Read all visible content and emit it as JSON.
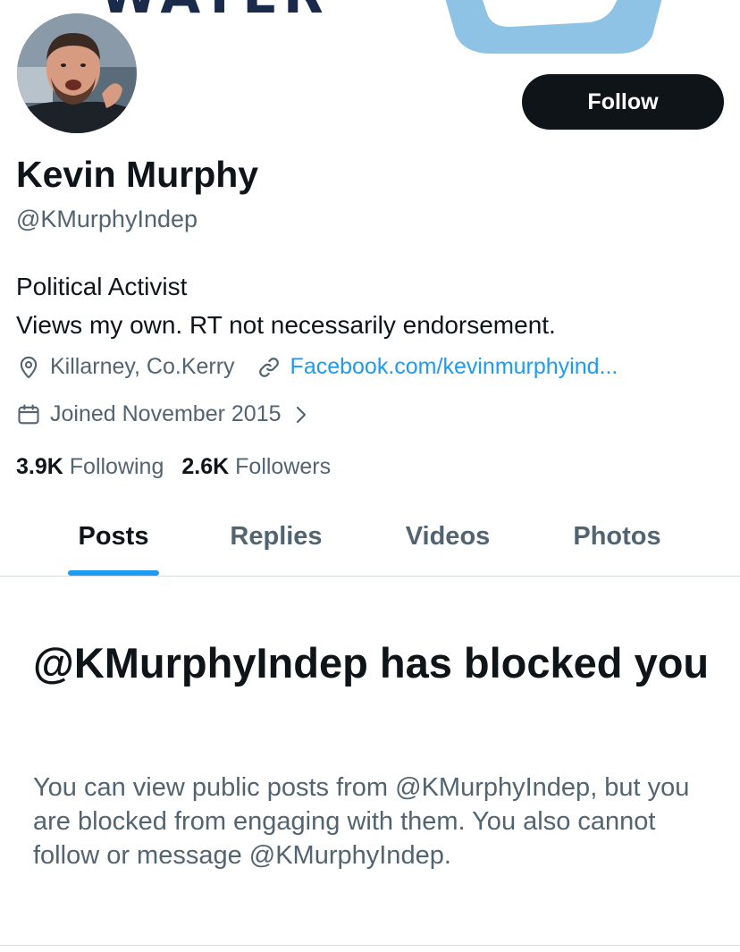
{
  "banner": {
    "text": "WATER"
  },
  "profile": {
    "name": "Kevin Murphy",
    "handle": "@KMurphyIndep",
    "bio_lines": [
      "Political Activist",
      "Views my own. RT not necessarily endorsement."
    ],
    "location": "Killarney, Co.Kerry",
    "website": "Facebook.com/kevinmurphyind...",
    "joined": "Joined November 2015",
    "following_count": "3.9K",
    "following_label": "Following",
    "followers_count": "2.6K",
    "followers_label": "Followers"
  },
  "actions": {
    "follow_label": "Follow"
  },
  "tabs": [
    {
      "label": "Posts",
      "active": true
    },
    {
      "label": "Replies",
      "active": false
    },
    {
      "label": "Videos",
      "active": false
    },
    {
      "label": "Photos",
      "active": false
    }
  ],
  "blocked_notice": {
    "title": "@KMurphyIndep has blocked you",
    "body": "You can view public posts from @KMurphyIndep, but you are blocked from engaging with them. You also cannot follow or message @KMurphyIndep."
  },
  "colors": {
    "accent": "#1d9bf0",
    "text_primary": "#0f1419",
    "text_secondary": "#536471",
    "button_bg": "#0f1419"
  },
  "icons": {
    "location": "location-pin-icon",
    "link": "link-icon",
    "calendar": "calendar-icon",
    "chevron": "chevron-right-icon"
  }
}
